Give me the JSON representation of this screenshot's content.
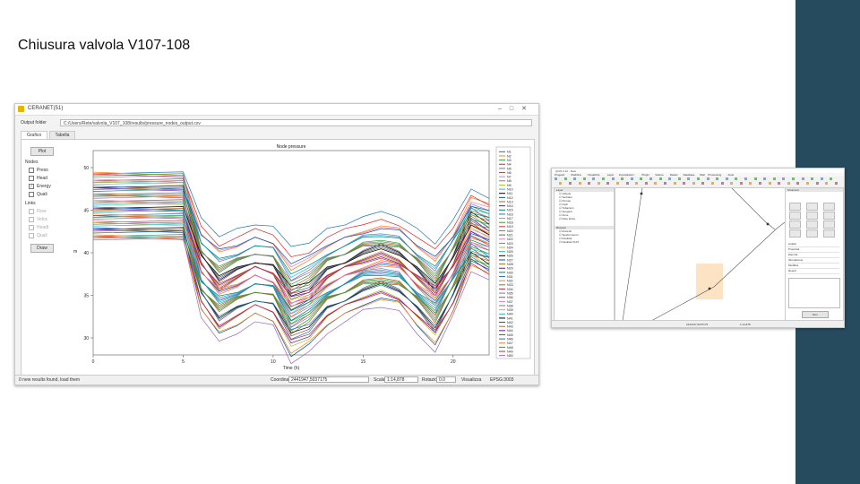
{
  "slide": {
    "title": "Chiusura valvola V107-108",
    "colors": {
      "sidebar": "#264a5e",
      "background": "#ffffff"
    }
  },
  "plugin_window": {
    "title": "CERANET(51)",
    "controls": [
      "minimize-icon",
      "maximize-icon",
      "close-icon"
    ],
    "path_label": "Output folder",
    "path_value": "C:/Users/Rete/valvola_V107_108/results/pressure_nodes_output.csv",
    "tabs": [
      "Grafico",
      "Tabella"
    ],
    "active_tab": "Grafico",
    "plot_button": "Plot",
    "group_nodes": "Nodes",
    "node_options": [
      {
        "label": "Press",
        "checked": false
      },
      {
        "label": "Head",
        "checked": false
      },
      {
        "label": "Energy",
        "checked": true
      },
      {
        "label": "Quali",
        "checked": false
      }
    ],
    "group_links": "Links",
    "link_options": [
      {
        "label": "Flow",
        "checked": false
      },
      {
        "label": "Veloc",
        "checked": false
      },
      {
        "label": "Headl",
        "checked": false
      },
      {
        "label": "Quali",
        "checked": false
      }
    ],
    "draw_button": "Draw",
    "status": {
      "left_text": "0 new results found, load them",
      "coord_label": "Coordinate",
      "coord_value": "2441947,5037175",
      "scale_label": "Scala",
      "scale_value": "1:14,878",
      "rotation_label": "Rotazione",
      "rotation_value": "0.0",
      "render_label": "Visualizza",
      "crs_label": "EPSG:3003"
    }
  },
  "chart_data": {
    "type": "line",
    "title": "Node pressure",
    "xlabel": "Time (h)",
    "ylabel": "m",
    "x": [
      0,
      5,
      6,
      7,
      8,
      9,
      10,
      11,
      12,
      13,
      14,
      15,
      16,
      17,
      18,
      19,
      20,
      21,
      22
    ],
    "xticks": [
      0,
      5,
      10,
      15,
      20
    ],
    "ylim": [
      28,
      52
    ],
    "yticks": [
      30,
      35,
      40,
      45,
      50
    ],
    "grid": false,
    "legend_position": "right",
    "shape": [
      0,
      0,
      -7.5,
      -10,
      -9,
      -8,
      -8.5,
      -12,
      -11,
      -9,
      -8,
      -7,
      -6.5,
      -7,
      -9,
      -11,
      -7.5,
      -3,
      -4
    ],
    "series_count": 50,
    "y_top": 49.5,
    "y_bottom": 41.5,
    "legend": [
      "N1",
      "N2",
      "N3",
      "N4",
      "N5",
      "N6",
      "N7",
      "N8",
      "N9",
      "N10",
      "N11",
      "N12",
      "N13",
      "N14",
      "N15",
      "N16",
      "N17",
      "N18",
      "N19",
      "N20",
      "N21",
      "N22",
      "N23",
      "N24",
      "N25",
      "N26",
      "N27",
      "N28",
      "N29",
      "N30",
      "N31",
      "N32",
      "N33",
      "N34",
      "N35",
      "N36",
      "N37",
      "N38",
      "N39",
      "N40",
      "N41",
      "N42",
      "N43",
      "N44",
      "N45",
      "N46",
      "N47",
      "N48",
      "N49",
      "N50"
    ],
    "palette": [
      "#1f77b4",
      "#ff7f0e",
      "#2ca02c",
      "#d62728",
      "#9467bd",
      "#8c564b",
      "#e377c2",
      "#7f7f7f",
      "#bcbd22",
      "#17becf",
      "#000000",
      "#0055a5",
      "#b5651d",
      "#6a0dad",
      "#008080"
    ]
  },
  "qgis_window": {
    "title": "QGIS 3.10 - Rete",
    "menu": [
      "Progetto",
      "Modifica",
      "Visualizza",
      "Layer",
      "Impostazioni",
      "Plugin",
      "Vettore",
      "Raster",
      "Database",
      "Web",
      "Processing",
      "Aiuto"
    ],
    "layers_header": "Layer",
    "layers": [
      "Valvole",
      "Serbatoi",
      "Pompe",
      "Nodi",
      "Tubazioni",
      "Sorgenti",
      "Zone",
      "Rete idrica"
    ],
    "browser_header": "Browser",
    "browser_items": [
      "Preferiti",
      "Spazio lavoro",
      "Risultati",
      "Risultati V107"
    ],
    "right_header": "Strumenti",
    "right_items": [
      "Analisi",
      "Proprietà",
      "Esporta",
      "Simulazione",
      "Modifica",
      "Report"
    ],
    "right_button": "Run",
    "status_coord": "2441947,5037175",
    "status_scale": "1:14,878",
    "map_colors": {
      "highlight": "#fbe3c4"
    }
  }
}
